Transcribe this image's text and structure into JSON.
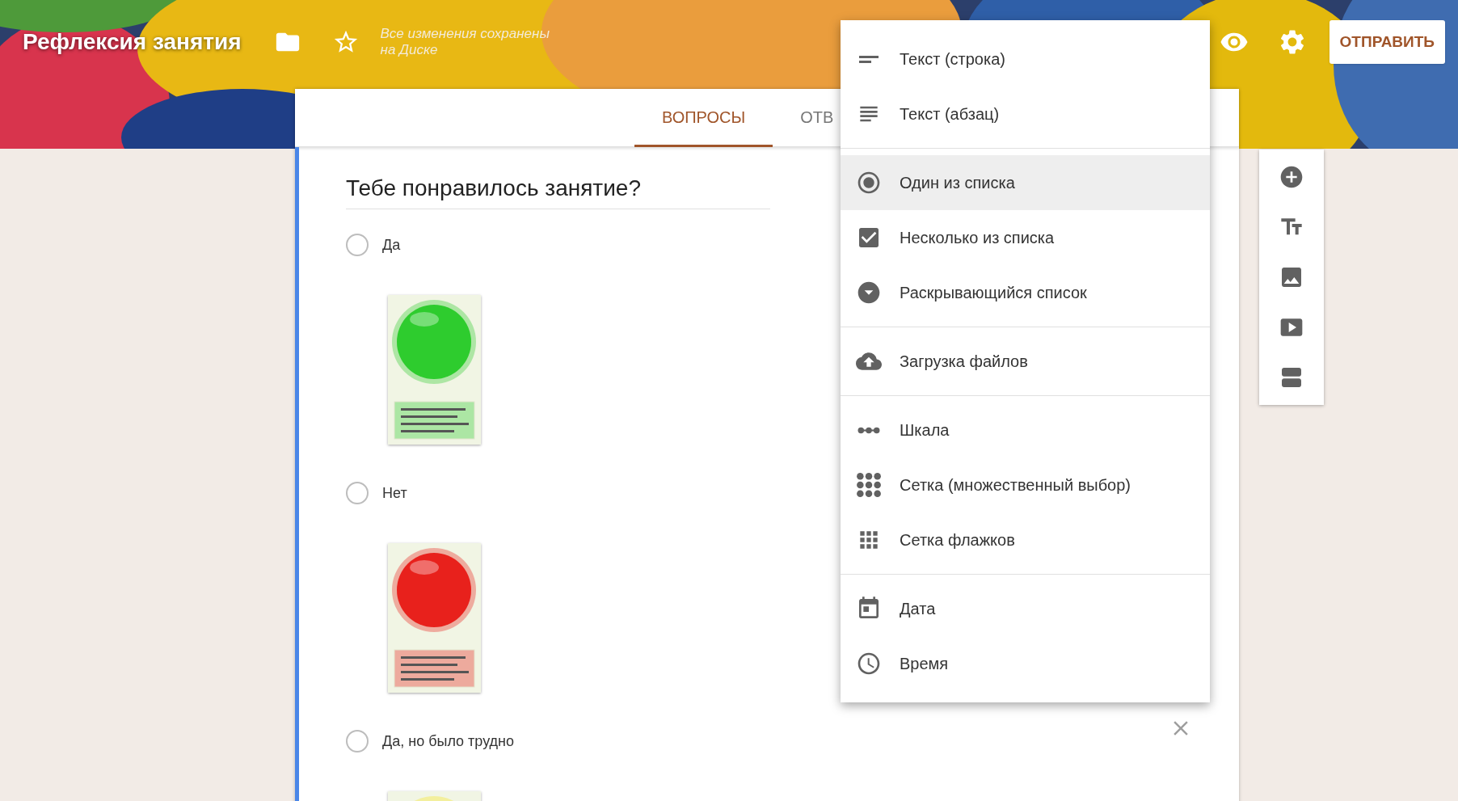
{
  "header": {
    "title": "Рефлексия занятия",
    "save_status": "Все изменения сохранены на Диске",
    "send_button": "ОТПРАВИТЬ"
  },
  "tabs": [
    {
      "label": "ВОПРОСЫ",
      "selected": true
    },
    {
      "label": "ОТВ",
      "selected": false
    }
  ],
  "question": {
    "title": "Тебе понравилось занятие?",
    "options": [
      {
        "label": "Да",
        "checked": false
      },
      {
        "label": "Нет",
        "checked": false
      },
      {
        "label": "Да, но было трудно",
        "checked": false
      }
    ]
  },
  "question_types_menu": {
    "groups": [
      [
        {
          "label": "Текст (строка)",
          "selected": false
        },
        {
          "label": "Текст (абзац)",
          "selected": false
        }
      ],
      [
        {
          "label": "Один из списка",
          "selected": true
        },
        {
          "label": "Несколько из списка",
          "selected": false
        },
        {
          "label": "Раскрывающийся список",
          "selected": false
        }
      ],
      [
        {
          "label": "Загрузка файлов",
          "selected": false
        }
      ],
      [
        {
          "label": "Шкала",
          "selected": false
        },
        {
          "label": "Сетка (множественный выбор)",
          "selected": false
        },
        {
          "label": "Сетка флажков",
          "selected": false
        }
      ],
      [
        {
          "label": "Дата",
          "selected": false
        },
        {
          "label": "Время",
          "selected": false
        }
      ]
    ]
  }
}
